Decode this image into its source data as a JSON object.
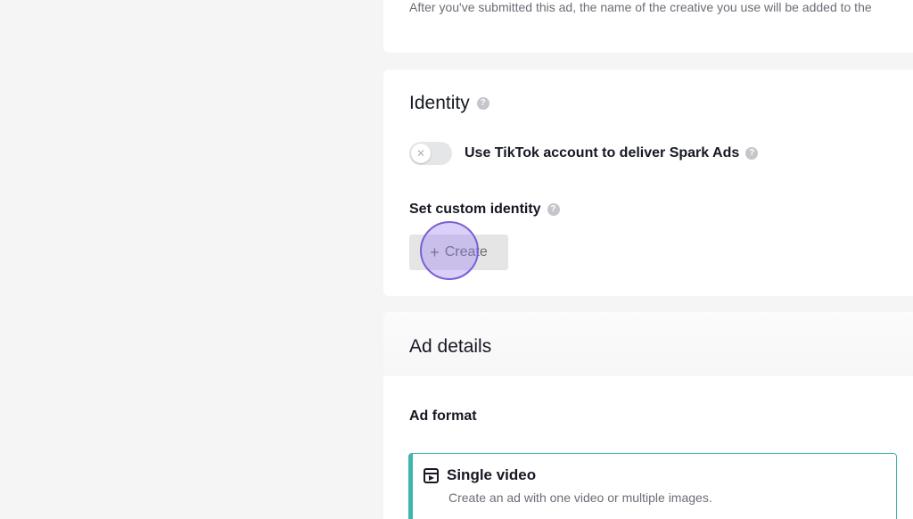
{
  "creative_notice": {
    "text": "After you've submitted this ad, the name of the creative you use will be added to the"
  },
  "identity": {
    "title": "Identity",
    "spark_toggle": {
      "label": "Use TikTok account to deliver Spark Ads",
      "state": "off"
    },
    "custom_identity_label": "Set custom identity",
    "create_button": {
      "icon": "plus-icon",
      "label": "Create"
    }
  },
  "ad_details": {
    "title": "Ad details",
    "ad_format_label": "Ad format",
    "format_option": {
      "icon": "video-icon",
      "title": "Single video",
      "description": "Create an ad with one video or multiple images."
    }
  },
  "colors": {
    "accent_teal": "#3fb5ad",
    "click_indicator": "#7b5fd8"
  }
}
